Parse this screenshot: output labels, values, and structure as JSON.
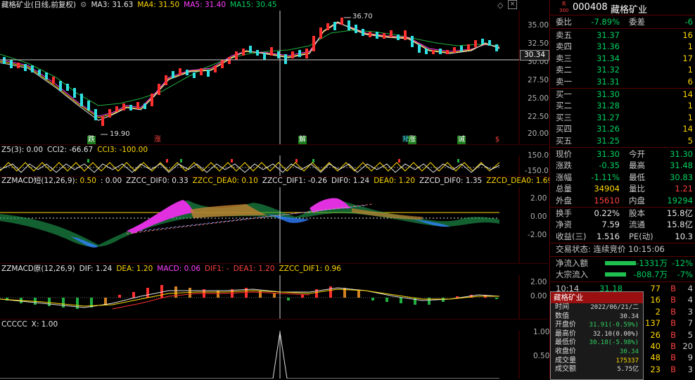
{
  "main_header": {
    "title": "藏格矿业(日线,前复权)",
    "ma3": "MA3: 31.63",
    "ma4": "MA4: 31.50",
    "ma5": "MA5: 31.40",
    "ma15": "MA15: 30.45"
  },
  "price_axis": [
    "35.00",
    "32.50",
    "30.00",
    "27.50",
    "25.00",
    "22.50",
    "20.00"
  ],
  "crosshair_price": "30.34",
  "annotations": {
    "high": "36.70",
    "low": "19.90"
  },
  "signals": [
    "跌",
    "涨",
    "解",
    "赌",
    "涨",
    "诫",
    "$"
  ],
  "z5_header": {
    "name": "Z5(3)",
    "v0": ": 0.00",
    "cci2": "CCI2: -66.67",
    "cci3": "CCI3: -100.00"
  },
  "z5_axis": [
    "150.0",
    "-150.0"
  ],
  "macd1_header": {
    "name": "ZZMACD短(12,26,9)",
    "a": ": 0.50",
    "b": ": 0.00",
    "c": "ZZCC_DIF0: 0.33",
    "d": "ZZCC_DEA0: 0.10",
    "e": "ZZCC_DIF1: -0.26",
    "f": "DIF0: 1.24",
    "g": "DEA0: 1.20",
    "h": "ZZCD_DIF0: 1.35",
    "i": "ZZCD_DEA0: 1.69"
  },
  "macd1_axis": [
    "2.00",
    "0.00",
    "-2.00"
  ],
  "macd2_header": {
    "name": "ZZMACD原(12,26,9)",
    "dif": "DIF: 1.24",
    "dea": "DEA: 1.20",
    "macd": "MACD: 0.06",
    "dif1": "DIF1: -",
    "dea1": "DEA1: 1.20",
    "zzcc": "ZZCC_DIF1: 0.96"
  },
  "macd2_axis": [
    "2.00",
    "0.00"
  ],
  "ccccc_header": {
    "name": "CCCCC",
    "x": "X: 1.00"
  },
  "ccccc_axis": [
    "1.00",
    "0.50"
  ],
  "quote": {
    "r_badge": "R",
    "badge_num": "300",
    "code": "000408",
    "name": "藏格矿业",
    "wb_label": "委比",
    "wb_val": "-7.89%",
    "wc_label": "委差",
    "wc_val": "-6",
    "asks": [
      {
        "label": "卖五",
        "price": "31.37",
        "vol": "16"
      },
      {
        "label": "卖四",
        "price": "31.36",
        "vol": "1"
      },
      {
        "label": "卖三",
        "price": "31.34",
        "vol": "17"
      },
      {
        "label": "卖二",
        "price": "31.32",
        "vol": "1"
      },
      {
        "label": "卖一",
        "price": "31.31",
        "vol": "6"
      }
    ],
    "bids": [
      {
        "label": "买一",
        "price": "31.30",
        "vol": "14"
      },
      {
        "label": "买二",
        "price": "31.28",
        "vol": "1"
      },
      {
        "label": "买三",
        "price": "31.27",
        "vol": "1"
      },
      {
        "label": "买四",
        "price": "31.26",
        "vol": "14"
      },
      {
        "label": "买五",
        "price": "31.25",
        "vol": "5"
      }
    ],
    "stats": [
      {
        "l1": "现价",
        "v1": "31.30",
        "l2": "今开",
        "v2": "31.30"
      },
      {
        "l1": "涨跌",
        "v1": "-0.35",
        "l2": "最高",
        "v2": "31.48"
      },
      {
        "l1": "涨幅",
        "v1": "-1.11%",
        "l2": "最低",
        "v2": "30.83"
      },
      {
        "l1": "总量",
        "v1": "34904",
        "l2": "量比",
        "v2": "1.21"
      },
      {
        "l1": "外盘",
        "v1": "15610",
        "l2": "内盘",
        "v2": "19294"
      }
    ],
    "stats2": [
      {
        "l1": "换手",
        "v1": "0.22%",
        "l2": "股本",
        "v2": "15.8亿"
      },
      {
        "l1": "净资",
        "v1": "7.59",
        "l2": "流通",
        "v2": "15.8亿"
      },
      {
        "l1": "收益(三)",
        "v1": "1.516",
        "l2": "PE(动)",
        "v2": "10.3"
      }
    ],
    "status": "交易状态: 连续竞价 10:15:06",
    "flows": [
      {
        "label": "净流入额",
        "val": "-1331万",
        "pct": "-12%"
      },
      {
        "label": "大宗流入",
        "val": "-808.7万",
        "pct": "-7%"
      }
    ],
    "ticks": [
      {
        "t": "10:14",
        "p": "31.18",
        "v": "77",
        "d": "B",
        "n": "4"
      },
      {
        "t": "",
        "p": "",
        "v": "16",
        "d": "B",
        "n": "4"
      },
      {
        "t": "",
        "p": "",
        "v": "2",
        "d": "B",
        "n": "3"
      },
      {
        "t": "",
        "p": "",
        "v": "137",
        "d": "B",
        "n": "7"
      },
      {
        "t": "",
        "p": "",
        "v": "26",
        "d": "B",
        "n": "5"
      },
      {
        "t": "",
        "p": "",
        "v": "40",
        "d": "B",
        "n": "20"
      },
      {
        "t": "",
        "p": "",
        "v": "48",
        "d": "B",
        "n": "9"
      },
      {
        "t": "",
        "p": "",
        "v": "23",
        "d": "B",
        "n": "3"
      }
    ]
  },
  "tooltip": {
    "title": "藏格矿业",
    "rows": [
      {
        "k": "时间",
        "v": "2022/06/21/二"
      },
      {
        "k": "数值",
        "v": "30.34"
      },
      {
        "k": "开盘价",
        "v": "31.91(-0.59%)"
      },
      {
        "k": "最高价",
        "v": "32.10(0.00%)"
      },
      {
        "k": "最低价",
        "v": "30.18(-5.98%)"
      },
      {
        "k": "收盘价",
        "v": "30.34"
      },
      {
        "k": "成交量",
        "v": "175337"
      },
      {
        "k": "成交额",
        "v": "5.75亿"
      }
    ]
  }
}
